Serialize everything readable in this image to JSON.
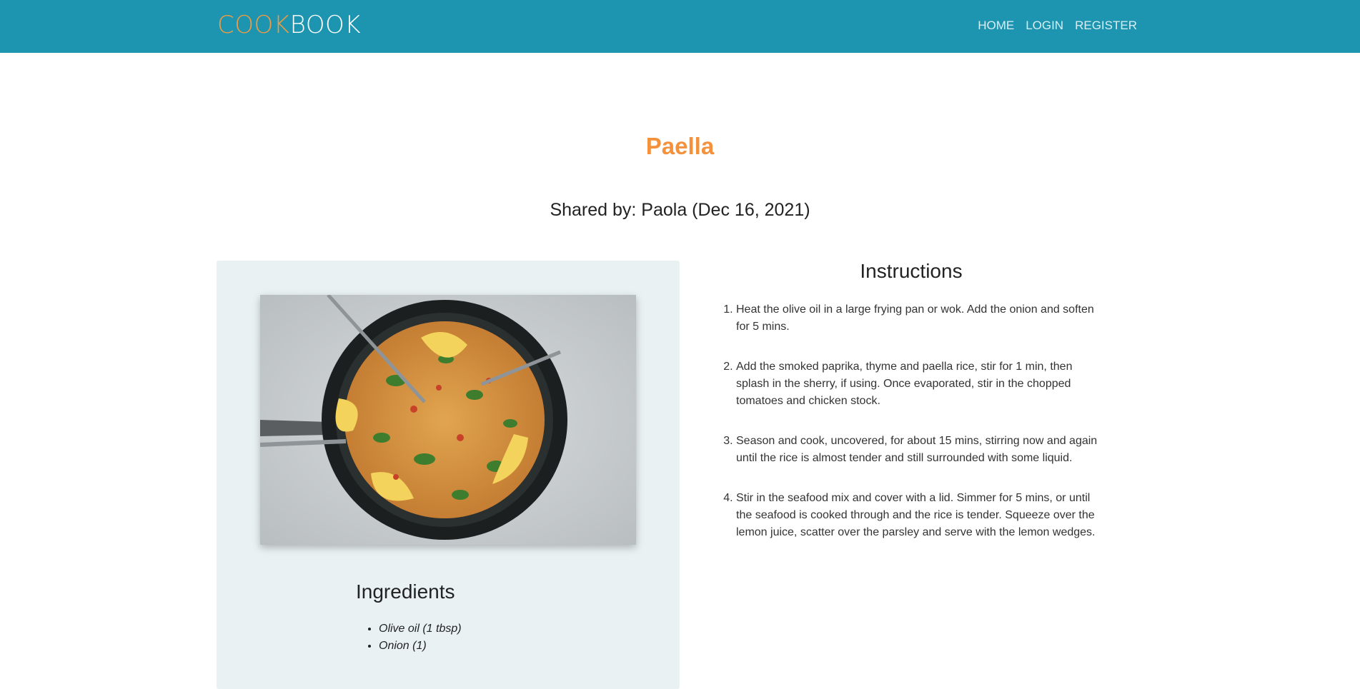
{
  "navbar": {
    "brand_part1": "COOK",
    "brand_part2": "BOOK",
    "links": [
      "HOME",
      "LOGIN",
      "REGISTER"
    ],
    "background": "#1e95b0",
    "brand_accent": "#f49a3e"
  },
  "recipe": {
    "title": "Paella",
    "shared_by": "Shared by: Paola (Dec 16, 2021)",
    "image_subject": "paella-dish-photo",
    "ingredients_heading": "Ingredients",
    "ingredients": [
      "Olive oil (1 tbsp)",
      "Onion (1)"
    ],
    "instructions_heading": "Instructions",
    "instructions": [
      "Heat the olive oil in a large frying pan or wok. Add the onion and soften for 5 mins.",
      "Add the smoked paprika, thyme and paella rice, stir for 1 min, then splash in the sherry, if using. Once evaporated, stir in the chopped tomatoes and chicken stock.",
      "Season and cook, uncovered, for about 15 mins, stirring now and again until the rice is almost tender and still surrounded with some liquid.",
      "Stir in the seafood mix and cover with a lid. Simmer for 5 mins, or until the seafood is cooked through and the rice is tender. Squeeze over the lemon juice, scatter over the parsley and serve with the lemon wedges."
    ],
    "title_color": "#f4913c"
  }
}
